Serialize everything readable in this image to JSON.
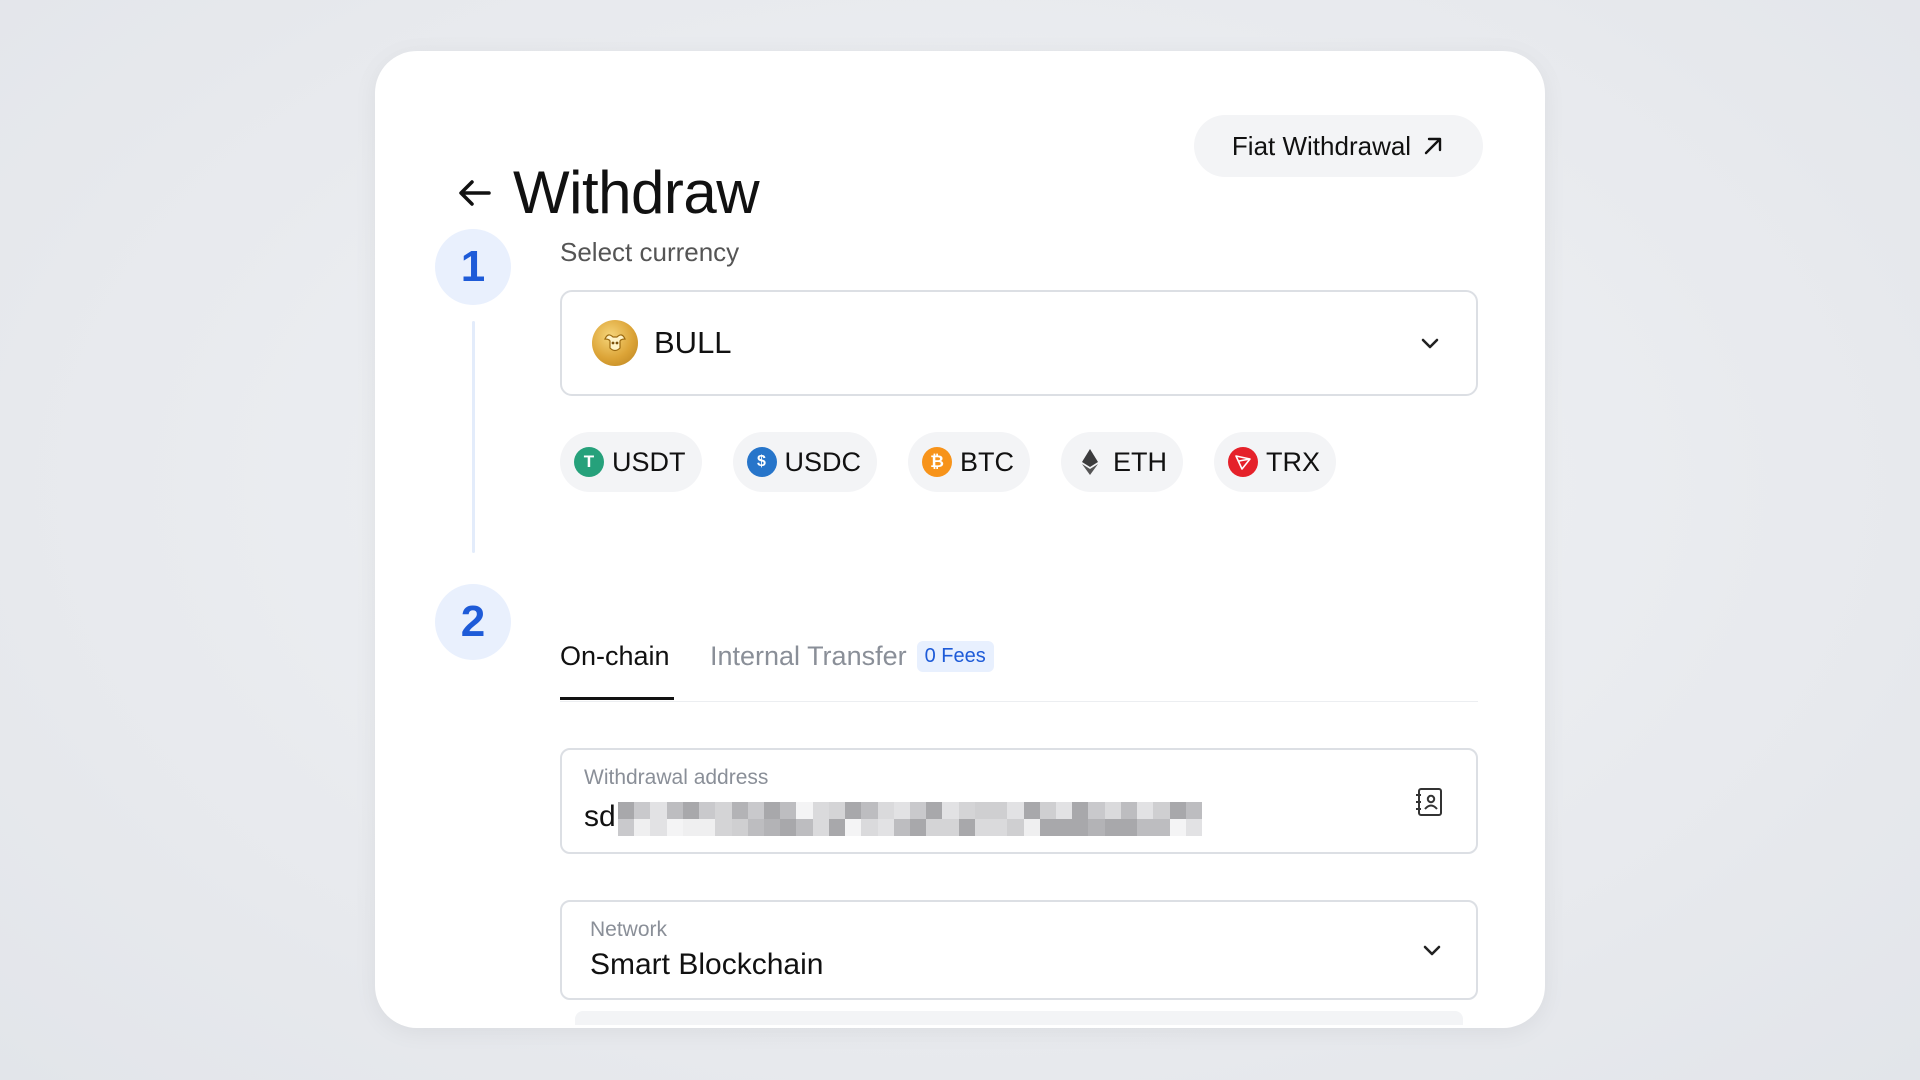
{
  "header": {
    "title": "Withdraw",
    "fiat_button_label": "Fiat Withdrawal"
  },
  "steps": {
    "one": "1",
    "two": "2"
  },
  "currency": {
    "label": "Select currency",
    "selected": "BULL",
    "quick_picks": [
      {
        "symbol": "USDT",
        "color": "#26a17b",
        "icon": "tether-icon"
      },
      {
        "symbol": "USDC",
        "color": "#2775ca",
        "icon": "usdc-icon"
      },
      {
        "symbol": "BTC",
        "color": "#f7931a",
        "icon": "bitcoin-icon"
      },
      {
        "symbol": "ETH",
        "color": "#3c3c3d",
        "icon": "ethereum-icon"
      },
      {
        "symbol": "TRX",
        "color": "#e5212a",
        "icon": "tron-icon"
      }
    ]
  },
  "tabs": {
    "onchain": "On-chain",
    "internal": "Internal Transfer",
    "internal_badge": "0 Fees"
  },
  "address": {
    "label": "Withdrawal address",
    "visible_prefix": "sd"
  },
  "network": {
    "label": "Network",
    "value": "Smart Blockchain"
  },
  "colors": {
    "accent": "#1e5bd8",
    "step_bg": "#e9f0fd"
  }
}
